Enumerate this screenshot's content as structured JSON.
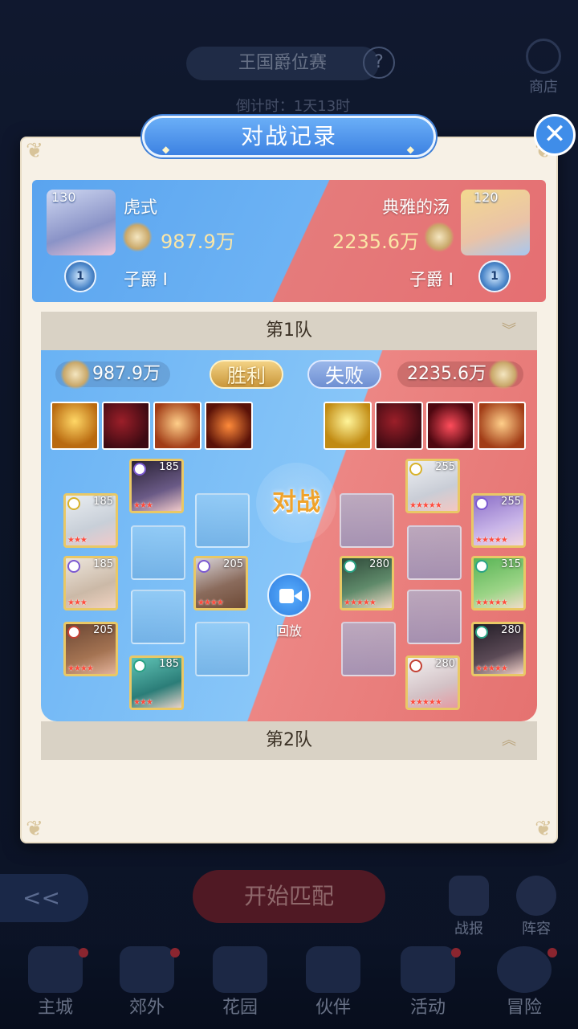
{
  "background": {
    "event_title": "王国爵位赛",
    "help_icon": "?",
    "countdown": "倒计时：1天13时",
    "shop_label": "商店",
    "match_button": "开始匹配",
    "back_icon": "<<",
    "report_label": "战报",
    "lineup_label": "阵容",
    "nav": [
      "主城",
      "郊外",
      "花园",
      "伙伴",
      "活动",
      "冒险"
    ]
  },
  "modal": {
    "title": "对战记录",
    "close_icon": "✕"
  },
  "summary": {
    "left": {
      "level": "130",
      "name": "虎式",
      "power": "987.9万",
      "rank": "子爵 Ⅰ",
      "badge": "1"
    },
    "right": {
      "level": "120",
      "name": "典雅的汤",
      "power": "2235.6万",
      "rank": "子爵 Ⅰ",
      "badge": "1"
    }
  },
  "team1": {
    "label": "第1队",
    "chevron": "︾",
    "left_power": "987.9万",
    "right_power": "2235.6万",
    "win_label": "胜利",
    "lose_label": "失败",
    "vs_label": "对战",
    "replay_label": "回放",
    "left_heroes": [
      {
        "level": "185"
      },
      {
        "level": "185"
      },
      {
        "level": "185"
      },
      {
        "level": "205"
      },
      {
        "level": "205"
      },
      {
        "level": "185"
      }
    ],
    "right_heroes": [
      {
        "level": "255"
      },
      {
        "level": "255"
      },
      {
        "level": "280"
      },
      {
        "level": "315"
      },
      {
        "level": "280"
      },
      {
        "level": "280"
      }
    ]
  },
  "team2": {
    "label": "第2队",
    "chevron": "︽"
  },
  "colors": {
    "blue_side": "#69b2f4",
    "red_side": "#e57270",
    "gold_frame": "#e9c866",
    "power_gold": "#fbe6a6"
  }
}
